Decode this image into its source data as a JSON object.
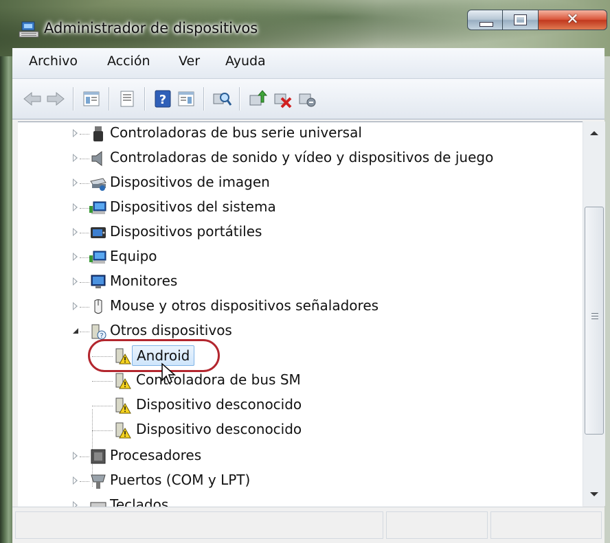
{
  "window": {
    "title": "Administrador de dispositivos"
  },
  "menu": [
    "Archivo",
    "Acción",
    "Ver",
    "Ayuda"
  ],
  "toolbar": {
    "icons": [
      "back-icon",
      "forward-icon",
      "show-hide-tree-icon",
      "properties-icon",
      "help-icon",
      "view-icon",
      "scan-hardware-icon",
      "update-driver-icon",
      "uninstall-icon",
      "disable-icon"
    ]
  },
  "tree": {
    "items": [
      {
        "label": "Controladoras de bus serie universal",
        "icon": "usb-icon",
        "expander": "closed",
        "level": 1
      },
      {
        "label": "Controladoras de sonido y vídeo y dispositivos de juego",
        "icon": "speaker-icon",
        "expander": "closed",
        "level": 1
      },
      {
        "label": "Dispositivos de imagen",
        "icon": "scanner-icon",
        "expander": "closed",
        "level": 1
      },
      {
        "label": "Dispositivos del sistema",
        "icon": "system-device-icon",
        "expander": "closed",
        "level": 1
      },
      {
        "label": "Dispositivos portátiles",
        "icon": "portable-device-icon",
        "expander": "closed",
        "level": 1
      },
      {
        "label": "Equipo",
        "icon": "computer-icon",
        "expander": "closed",
        "level": 1
      },
      {
        "label": "Monitores",
        "icon": "monitor-icon",
        "expander": "closed",
        "level": 1
      },
      {
        "label": "Mouse y otros dispositivos señaladores",
        "icon": "mouse-icon",
        "expander": "closed",
        "level": 1
      },
      {
        "label": "Otros dispositivos",
        "icon": "unknown-device-icon",
        "expander": "open",
        "level": 1
      },
      {
        "label": "Android",
        "icon": "warning-device-icon",
        "level": 2,
        "selected": true
      },
      {
        "label": "Controladora de bus SM",
        "icon": "warning-device-icon",
        "level": 2
      },
      {
        "label": "Dispositivo desconocido",
        "icon": "warning-device-icon",
        "level": 2
      },
      {
        "label": "Dispositivo desconocido",
        "icon": "warning-device-icon",
        "level": 2
      },
      {
        "label": "Procesadores",
        "icon": "processor-icon",
        "expander": "closed",
        "level": 1
      },
      {
        "label": "Puertos (COM y LPT)",
        "icon": "port-icon",
        "expander": "closed",
        "level": 1
      },
      {
        "label": "Teclados",
        "icon": "keyboard-icon",
        "expander": "closed",
        "level": 1
      }
    ]
  },
  "colors": {
    "highlight_ring": "#b3262e",
    "selection": "#cfe5fb",
    "accent": "#3a6ea5"
  }
}
